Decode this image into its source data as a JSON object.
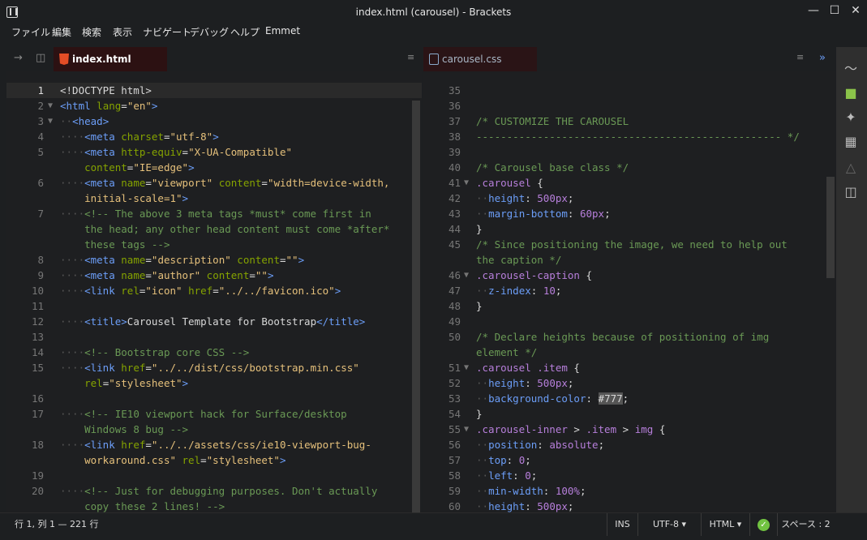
{
  "window": {
    "title": "index.html (carousel) - Brackets",
    "minimize_icon": "minimize-icon",
    "maximize_icon": "maximize-icon",
    "close_icon": "close-icon"
  },
  "menu": [
    "ファイル",
    "編集",
    "検索",
    "表示",
    "ナビゲート",
    "デバッグ",
    "ヘルプ",
    "Emmet"
  ],
  "left_pane": {
    "tab_label": "index.html",
    "lines": [
      {
        "n": "1",
        "fold": "",
        "html": "<span class='dt'>&lt;!DOCTYPE html&gt;</span>"
      },
      {
        "n": "2",
        "fold": "▼",
        "html": "<span class='tg'>&lt;html</span> <span class='at'>lang</span>=<span class='vl'>\"en\"</span><span class='tg'>&gt;</span>"
      },
      {
        "n": "3",
        "fold": "▼",
        "html": "<span class='ind'>··</span><span class='tg'>&lt;head&gt;</span>"
      },
      {
        "n": "4",
        "fold": "",
        "html": "<span class='ind'>····</span><span class='tg'>&lt;meta</span> <span class='at'>charset</span>=<span class='vl'>\"utf-8\"</span><span class='tg'>&gt;</span>"
      },
      {
        "n": "5",
        "fold": "",
        "html": "<span class='ind'>····</span><span class='tg'>&lt;meta</span> <span class='at'>http-equiv</span>=<span class='vl'>\"X-UA-Compatible\"</span>"
      },
      {
        "n": "",
        "fold": "",
        "html": "    <span class='at'>content</span>=<span class='vl'>\"IE=edge\"</span><span class='tg'>&gt;</span>"
      },
      {
        "n": "6",
        "fold": "",
        "html": "<span class='ind'>····</span><span class='tg'>&lt;meta</span> <span class='at'>name</span>=<span class='vl'>\"viewport\"</span> <span class='at'>content</span>=<span class='vl'>\"width=device-width,</span>"
      },
      {
        "n": "",
        "fold": "",
        "html": "    <span class='vl'>initial-scale=1\"</span><span class='tg'>&gt;</span>"
      },
      {
        "n": "7",
        "fold": "",
        "html": "<span class='ind'>····</span><span class='cm'>&lt;!-- The above 3 meta tags *must* come first in</span>"
      },
      {
        "n": "",
        "fold": "",
        "html": "    <span class='cm'>the head; any other head content must come *after*</span>"
      },
      {
        "n": "",
        "fold": "",
        "html": "    <span class='cm'>these tags --&gt;</span>"
      },
      {
        "n": "8",
        "fold": "",
        "html": "<span class='ind'>····</span><span class='tg'>&lt;meta</span> <span class='at'>name</span>=<span class='vl'>\"description\"</span> <span class='at'>content</span>=<span class='vl'>\"\"</span><span class='tg'>&gt;</span>"
      },
      {
        "n": "9",
        "fold": "",
        "html": "<span class='ind'>····</span><span class='tg'>&lt;meta</span> <span class='at'>name</span>=<span class='vl'>\"author\"</span> <span class='at'>content</span>=<span class='vl'>\"\"</span><span class='tg'>&gt;</span>"
      },
      {
        "n": "10",
        "fold": "",
        "html": "<span class='ind'>····</span><span class='tg'>&lt;link</span> <span class='at'>rel</span>=<span class='vl'>\"icon\"</span> <span class='at'>href</span>=<span class='vl'>\"../../favicon.ico\"</span><span class='tg'>&gt;</span>"
      },
      {
        "n": "11",
        "fold": "",
        "html": ""
      },
      {
        "n": "12",
        "fold": "",
        "html": "<span class='ind'>····</span><span class='tg'>&lt;title&gt;</span><span class='dt'>Carousel Template for Bootstrap</span><span class='tg'>&lt;/title&gt;</span>"
      },
      {
        "n": "13",
        "fold": "",
        "html": ""
      },
      {
        "n": "14",
        "fold": "",
        "html": "<span class='ind'>····</span><span class='cm'>&lt;!-- Bootstrap core CSS --&gt;</span>"
      },
      {
        "n": "15",
        "fold": "",
        "html": "<span class='ind'>····</span><span class='tg'>&lt;link</span> <span class='at'>href</span>=<span class='vl'>\"../../dist/css/bootstrap.min.css\"</span>"
      },
      {
        "n": "",
        "fold": "",
        "html": "    <span class='at'>rel</span>=<span class='vl'>\"stylesheet\"</span><span class='tg'>&gt;</span>"
      },
      {
        "n": "16",
        "fold": "",
        "html": ""
      },
      {
        "n": "17",
        "fold": "",
        "html": "<span class='ind'>····</span><span class='cm'>&lt;!-- IE10 viewport hack for Surface/desktop</span>"
      },
      {
        "n": "",
        "fold": "",
        "html": "    <span class='cm'>Windows 8 bug --&gt;</span>"
      },
      {
        "n": "18",
        "fold": "",
        "html": "<span class='ind'>····</span><span class='tg'>&lt;link</span> <span class='at'>href</span>=<span class='vl'>\"../../assets/css/ie10-viewport-bug-</span>"
      },
      {
        "n": "",
        "fold": "",
        "html": "    <span class='vl'>workaround.css\"</span> <span class='at'>rel</span>=<span class='vl'>\"stylesheet\"</span><span class='tg'>&gt;</span>"
      },
      {
        "n": "19",
        "fold": "",
        "html": ""
      },
      {
        "n": "20",
        "fold": "",
        "html": "<span class='ind'>····</span><span class='cm'>&lt;!-- Just for debugging purposes. Don't actually</span>"
      },
      {
        "n": "",
        "fold": "",
        "html": "    <span class='cm'>copy these 2 lines! --&gt;</span>"
      }
    ]
  },
  "right_pane": {
    "tab_label": "carousel.css",
    "lines": [
      {
        "n": "35",
        "fold": "",
        "html": ""
      },
      {
        "n": "36",
        "fold": "",
        "html": ""
      },
      {
        "n": "37",
        "fold": "",
        "html": "<span class='cm'>/* CUSTOMIZE THE CAROUSEL</span>"
      },
      {
        "n": "38",
        "fold": "",
        "html": "<span class='cm'>-------------------------------------------------- */</span>"
      },
      {
        "n": "39",
        "fold": "",
        "html": ""
      },
      {
        "n": "40",
        "fold": "",
        "html": "<span class='cm'>/* Carousel base class */</span>"
      },
      {
        "n": "41",
        "fold": "▼",
        "html": "<span class='sel'>.carousel</span> <span class='dt'>{</span>"
      },
      {
        "n": "42",
        "fold": "",
        "html": "<span class='ind'>··</span><span class='pr'>height</span><span class='dt'>: </span><span class='vv'>500px</span><span class='dt'>;</span>"
      },
      {
        "n": "43",
        "fold": "",
        "html": "<span class='ind'>··</span><span class='pr'>margin-bottom</span><span class='dt'>: </span><span class='vv'>60px</span><span class='dt'>;</span>"
      },
      {
        "n": "44",
        "fold": "",
        "html": "<span class='dt'>}</span>"
      },
      {
        "n": "45",
        "fold": "",
        "html": "<span class='cm'>/* Since positioning the image, we need to help out</span>"
      },
      {
        "n": "",
        "fold": "",
        "html": "<span class='cm'>the caption */</span>"
      },
      {
        "n": "46",
        "fold": "▼",
        "html": "<span class='sel'>.carousel-caption</span> <span class='dt'>{</span>"
      },
      {
        "n": "47",
        "fold": "",
        "html": "<span class='ind'>··</span><span class='pr'>z-index</span><span class='dt'>: </span><span class='vv'>10</span><span class='dt'>;</span>"
      },
      {
        "n": "48",
        "fold": "",
        "html": "<span class='dt'>}</span>"
      },
      {
        "n": "49",
        "fold": "",
        "html": ""
      },
      {
        "n": "50",
        "fold": "",
        "html": "<span class='cm'>/* Declare heights because of positioning of img</span>"
      },
      {
        "n": "",
        "fold": "",
        "html": "<span class='cm'>element */</span>"
      },
      {
        "n": "51",
        "fold": "▼",
        "html": "<span class='sel'>.carousel .item</span> <span class='dt'>{</span>"
      },
      {
        "n": "52",
        "fold": "",
        "html": "<span class='ind'>··</span><span class='pr'>height</span><span class='dt'>: </span><span class='vv'>500px</span><span class='dt'>;</span>"
      },
      {
        "n": "53",
        "fold": "",
        "html": "<span class='ind'>··</span><span class='pr'>background-color</span><span class='dt'>: </span><span class='dt' style='background:#555'>#777</span><span class='dt'>;</span>"
      },
      {
        "n": "54",
        "fold": "",
        "html": "<span class='dt'>}</span>"
      },
      {
        "n": "55",
        "fold": "▼",
        "html": "<span class='sel'>.carousel-inner</span> <span class='dt'>&gt;</span> <span class='sel'>.item</span> <span class='dt'>&gt;</span> <span class='sel'>img</span> <span class='dt'>{</span>"
      },
      {
        "n": "56",
        "fold": "",
        "html": "<span class='ind'>··</span><span class='pr'>position</span><span class='dt'>: </span><span class='vv'>absolute</span><span class='dt'>;</span>"
      },
      {
        "n": "57",
        "fold": "",
        "html": "<span class='ind'>··</span><span class='pr'>top</span><span class='dt'>: </span><span class='vv'>0</span><span class='dt'>;</span>"
      },
      {
        "n": "58",
        "fold": "",
        "html": "<span class='ind'>··</span><span class='pr'>left</span><span class='dt'>: </span><span class='vv'>0</span><span class='dt'>;</span>"
      },
      {
        "n": "59",
        "fold": "",
        "html": "<span class='ind'>··</span><span class='pr'>min-width</span><span class='dt'>: </span><span class='vv'>100%</span><span class='dt'>;</span>"
      },
      {
        "n": "60",
        "fold": "",
        "html": "<span class='ind'>··</span><span class='pr'>height</span><span class='dt'>: </span><span class='vv'>500px</span><span class='dt'>;</span>"
      }
    ]
  },
  "statusbar": {
    "cursor": "行 1, 列 1 — 221 行",
    "mode": "INS",
    "encoding": "UTF-8 ▾",
    "language": "HTML ▾",
    "indent": "スペース : 2"
  },
  "colors": {
    "tab_bg": "#2c1112",
    "accent": "#6c9ef8"
  },
  "toolbar_icons": [
    "live-preview-icon",
    "extension-manager-icon",
    "wand-icon",
    "grid-icon",
    "bottle-icon",
    "code-file-icon"
  ]
}
